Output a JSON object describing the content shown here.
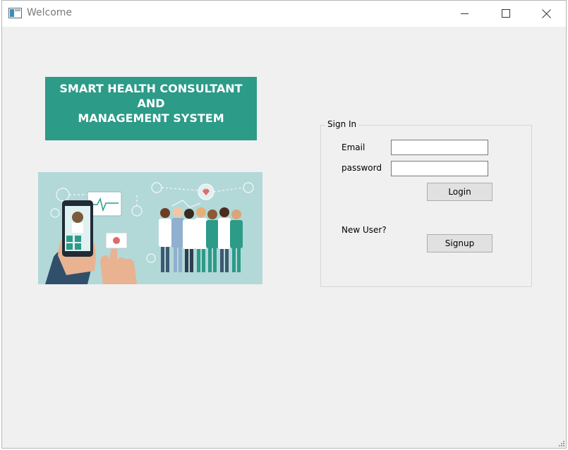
{
  "window": {
    "title": "Welcome",
    "controls": {
      "minimize": "minimize",
      "maximize": "maximize",
      "close": "close"
    }
  },
  "banner": {
    "lines": [
      "SMART HEALTH CONSULTANT",
      "AND",
      "MANAGEMENT SYSTEM"
    ],
    "background": "#2c9b88"
  },
  "illustration": {
    "subject": "doctors-and-smartphone-illustration"
  },
  "signin": {
    "group_title": "Sign In",
    "email_label": "Email",
    "email_value": "",
    "password_label": "password",
    "password_value": "",
    "login_label": "Login",
    "new_user_label": "New User?",
    "signup_label": "Signup"
  },
  "colors": {
    "accent": "#2c9b88",
    "window_bg": "#f0f0f0",
    "button_bg": "#e1e1e1"
  }
}
